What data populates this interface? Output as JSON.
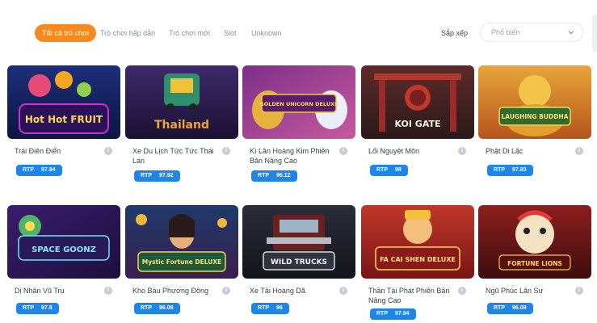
{
  "filters": {
    "tabs": [
      {
        "label": "Tất cả trò chơi",
        "active": true
      },
      {
        "label": "Trò chơi hấp dẫn",
        "active": false
      },
      {
        "label": "Trò chơi mới",
        "active": false
      },
      {
        "label": "Slot",
        "active": false
      },
      {
        "label": "Unknown",
        "active": false
      }
    ],
    "sort_label": "Sắp xếp",
    "sort_value": "Phổ biến"
  },
  "games": [
    {
      "name": "Trái Điên Điển",
      "rtp_label": "RTP",
      "rtp": "97.94",
      "logo": "Hot Hot FRUIT"
    },
    {
      "name": "Xe Du Lịch Tức Tức Thái Lan",
      "rtp_label": "RTP",
      "rtp": "97.92",
      "logo": "Thailand"
    },
    {
      "name": "Kì Lân Hoàng Kim Phiên Bản Nâng Cao",
      "rtp_label": "RTP",
      "rtp": "96.12",
      "logo": "GOLDEN UNICORN DELUXE"
    },
    {
      "name": "Lối Nguyệt Môn",
      "rtp_label": "RTP",
      "rtp": "98",
      "logo": "KOI GATE"
    },
    {
      "name": "Phật Di Lặc",
      "rtp_label": "RTP",
      "rtp": "97.93",
      "logo": "LAUGHING BUDDHA"
    },
    {
      "name": "Dị Nhân Vũ Trụ",
      "rtp_label": "RTP",
      "rtp": "97.8",
      "logo": "SPACE GOONZ"
    },
    {
      "name": "Kho Báu Phương Đông",
      "rtp_label": "RTP",
      "rtp": "96.06",
      "logo": "Mystic Fortune DELUXE"
    },
    {
      "name": "Xe Tải Hoang Dã",
      "rtp_label": "RTP",
      "rtp": "96",
      "logo": "WILD TRUCKS"
    },
    {
      "name": "Thần Tài Phát Phiên Bản Nâng Cao",
      "rtp_label": "RTP",
      "rtp": "97.94",
      "logo": "FA CAI SHEN DELUXE"
    },
    {
      "name": "Ngũ Phúc Lân Sư",
      "rtp_label": "RTP",
      "rtp": "96.09",
      "logo": "FORTUNE LIONS"
    }
  ],
  "colors": {
    "accent": "#f78a1e",
    "rtp_badge": "#1f86e9"
  },
  "icons": {
    "info": "info-icon",
    "chevron": "chevron-down-icon"
  }
}
